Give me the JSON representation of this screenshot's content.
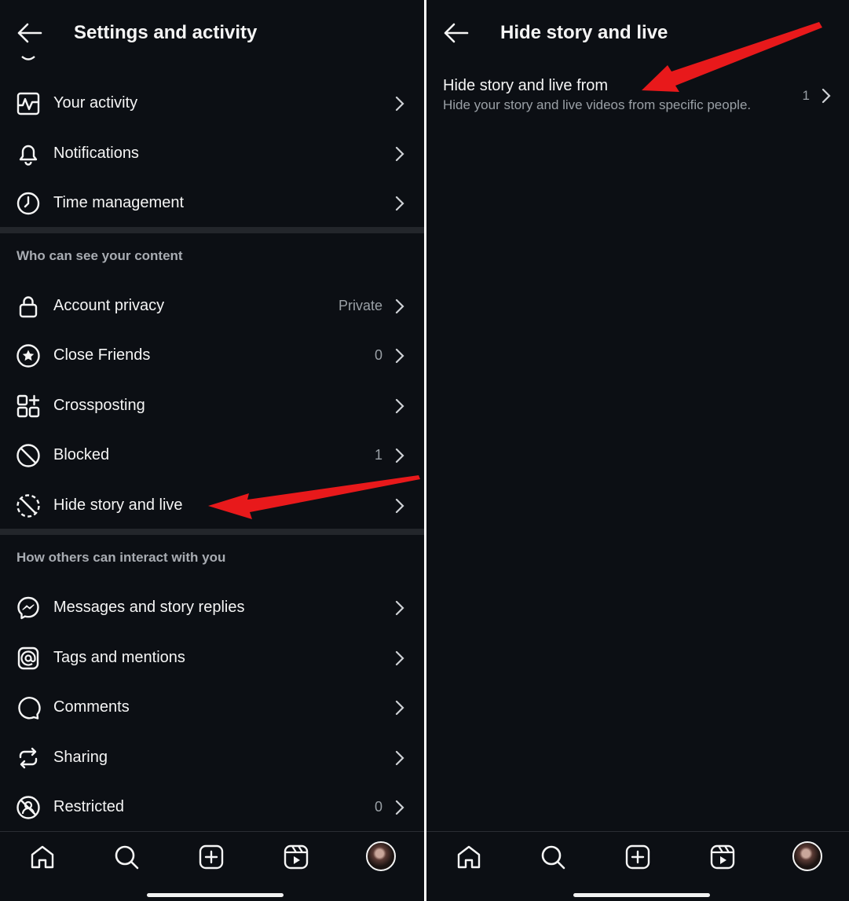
{
  "left": {
    "header": {
      "title": "Settings and activity"
    },
    "items_top": [
      {
        "label": "Your activity",
        "icon": "activity-icon"
      },
      {
        "label": "Notifications",
        "icon": "bell-icon"
      },
      {
        "label": "Time management",
        "icon": "clock-icon"
      }
    ],
    "section_content": {
      "title": "Who can see your content"
    },
    "items_content": [
      {
        "label": "Account privacy",
        "value": "Private",
        "icon": "lock-icon"
      },
      {
        "label": "Close Friends",
        "value": "0",
        "icon": "star-circle-icon"
      },
      {
        "label": "Crossposting",
        "value": "",
        "icon": "crosspost-icon"
      },
      {
        "label": "Blocked",
        "value": "1",
        "icon": "blocked-icon"
      },
      {
        "label": "Hide story and live",
        "value": "",
        "icon": "hide-story-icon"
      }
    ],
    "section_interact": {
      "title": "How others can interact with you"
    },
    "items_interact": [
      {
        "label": "Messages and story replies",
        "icon": "messenger-icon"
      },
      {
        "label": "Tags and mentions",
        "icon": "at-sign-icon"
      },
      {
        "label": "Comments",
        "icon": "comment-icon"
      },
      {
        "label": "Sharing",
        "icon": "share-repeat-icon"
      },
      {
        "label": "Restricted",
        "value": "0",
        "icon": "restricted-icon"
      }
    ]
  },
  "right": {
    "header": {
      "title": "Hide story and live"
    },
    "hide_from": {
      "title": "Hide story and live from",
      "subtitle": "Hide your story and live videos from specific people.",
      "value": "1"
    }
  },
  "nav": [
    "home-icon",
    "search-icon",
    "create-icon",
    "reels-icon",
    "profile-avatar"
  ],
  "colors": {
    "background": "#0c0f14",
    "text": "#f5f5f5",
    "muted": "#9aa0a6",
    "arrow": "#e8191b",
    "divider": "#23262b"
  }
}
